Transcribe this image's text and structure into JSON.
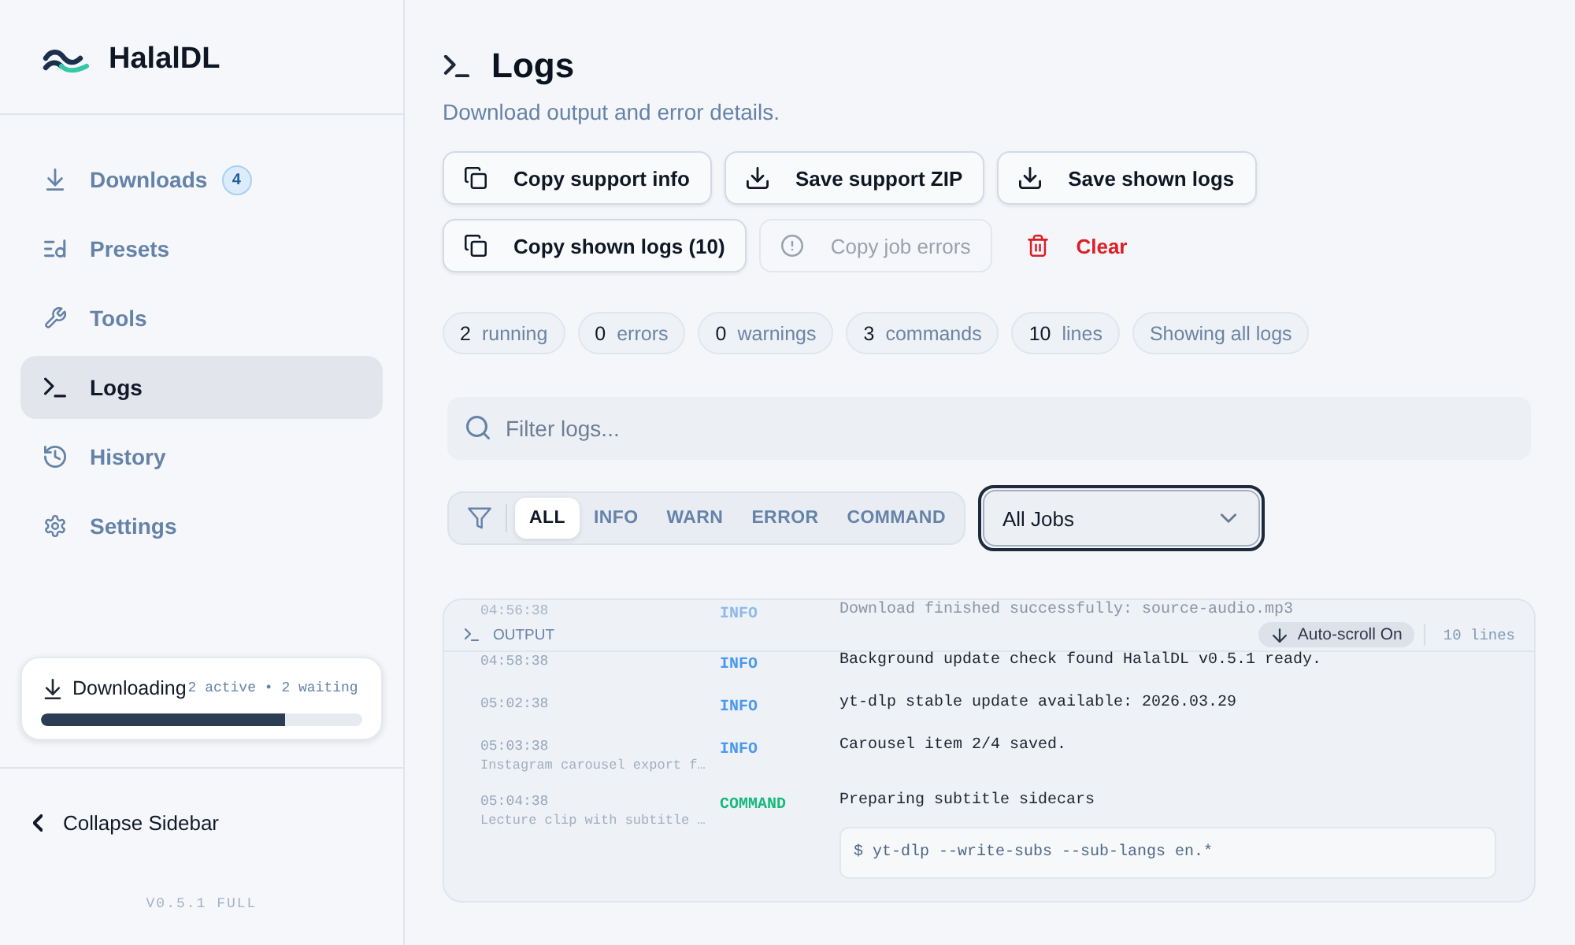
{
  "app": {
    "name": "HalalDL"
  },
  "sidebar": {
    "items": [
      {
        "label": "Downloads",
        "badge": "4",
        "selected": false
      },
      {
        "label": "Presets",
        "selected": false
      },
      {
        "label": "Tools",
        "selected": false
      },
      {
        "label": "Logs",
        "selected": true
      },
      {
        "label": "History",
        "selected": false
      },
      {
        "label": "Settings",
        "selected": false
      }
    ],
    "download_status": {
      "label": "Downloading",
      "detail": "2 active • 2 waiting",
      "level": 0.76
    },
    "collapse": "Collapse Sidebar",
    "version": "V0.5.1 FULL"
  },
  "page": {
    "title": "Logs",
    "subtitle": "Download output and error details."
  },
  "action_rows": [
    [
      {
        "label": "Copy support info",
        "kind": "copy",
        "disabled": false
      },
      {
        "label": "Save support ZIP",
        "kind": "save",
        "disabled": false
      },
      {
        "label": "Save shown logs",
        "kind": "save",
        "disabled": false
      }
    ],
    [
      {
        "label": "Copy shown logs (10)",
        "kind": "copy",
        "disabled": false
      },
      {
        "label": "Copy job errors",
        "kind": "errors",
        "disabled": true
      },
      {
        "label": "Clear",
        "kind": "clear",
        "disabled": false
      }
    ]
  ],
  "stats": [
    {
      "value": "2",
      "label": "running"
    },
    {
      "value": "0",
      "label": "errors"
    },
    {
      "value": "0",
      "label": "warnings"
    },
    {
      "value": "3",
      "label": "commands"
    },
    {
      "value": "10",
      "label": "lines"
    },
    {
      "label": "Showing all logs"
    }
  ],
  "search": {
    "placeholder": "Filter logs..."
  },
  "level_filter": [
    {
      "label": "ALL",
      "selected": true
    },
    {
      "label": "INFO",
      "selected": false
    },
    {
      "label": "WARN",
      "selected": false
    },
    {
      "label": "ERROR",
      "selected": false
    },
    {
      "label": "COMMAND",
      "selected": false
    }
  ],
  "job_select": {
    "value": "All Jobs",
    "focused": true
  },
  "output": {
    "title": "OUTPUT",
    "autoscroll": "Auto-scroll On",
    "line_count": "10 lines",
    "rows": [
      {
        "time": "04:56:38",
        "level": "INFO",
        "kind": "info",
        "message": "Download finished successfully: source-audio.mp3",
        "dimmed": true
      },
      {
        "time": "04:58:38",
        "level": "INFO",
        "kind": "info",
        "message": "Background update check found HalalDL v0.5.1 ready.",
        "dimmed": false
      },
      {
        "time": "05:02:38",
        "level": "INFO",
        "kind": "info",
        "message": "yt-dlp stable update available: 2026.03.29",
        "dimmed": false
      },
      {
        "time": "05:03:38",
        "source": "Instagram carousel export f…",
        "level": "INFO",
        "kind": "info",
        "message": "Carousel item 2/4 saved.",
        "dimmed": false
      },
      {
        "time": "05:04:38",
        "source": "Lecture clip with subtitle …",
        "level": "COMMAND",
        "kind": "command",
        "message": "Preparing subtitle sidecars",
        "command": "$ yt-dlp --write-subs --sub-langs en.*",
        "dimmed": false
      }
    ]
  }
}
